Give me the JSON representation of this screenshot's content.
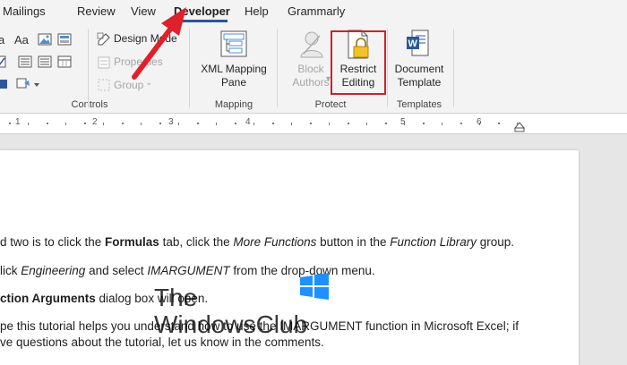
{
  "tabs": [
    {
      "label": "Mailings"
    },
    {
      "label": "Review"
    },
    {
      "label": "View"
    },
    {
      "label": "Developer"
    },
    {
      "label": "Help"
    },
    {
      "label": "Grammarly"
    }
  ],
  "controls": {
    "design_mode": "Design Mode",
    "properties": "Properties",
    "group": "Group",
    "group_label": "Controls"
  },
  "mapping": {
    "xml_pane_line1": "XML Mapping",
    "xml_pane_line2": "Pane",
    "group_label": "Mapping"
  },
  "protect": {
    "block_authors_line1": "Block",
    "block_authors_line2": "Authors",
    "restrict_line1": "Restrict",
    "restrict_line2": "Editing",
    "group_label": "Protect"
  },
  "templates": {
    "doc_template_line1": "Document",
    "doc_template_line2": "Template",
    "group_label": "Templates"
  },
  "ruler": {
    "numbers": [
      "1",
      "2",
      "3",
      "4",
      "5",
      "6"
    ]
  },
  "document": {
    "line1": {
      "a": "d two is to click the ",
      "b": "Formulas",
      "c": " tab, click the ",
      "d": "More Functions",
      "e": " button in the ",
      "f": "Function Library",
      "g": " group."
    },
    "line2": {
      "a": "lick ",
      "b": "Engineering",
      "c": " and select ",
      "d": "IMARGUMENT",
      "e": " from the drop-down menu."
    },
    "line3": {
      "a": "ction Arguments",
      "b": " dialog box will open."
    },
    "line4": "pe this tutorial helps you understand how to use the IMARGUMENT function in Microsoft Excel; if",
    "line5": "ve questions about the tutorial, let us know in the comments."
  },
  "watermark": {
    "line1": "The",
    "line2": "WindowsClub"
  },
  "colors": {
    "accent": "#2b579a",
    "highlight_box": "#d0202a",
    "arrow": "#e0202a"
  }
}
